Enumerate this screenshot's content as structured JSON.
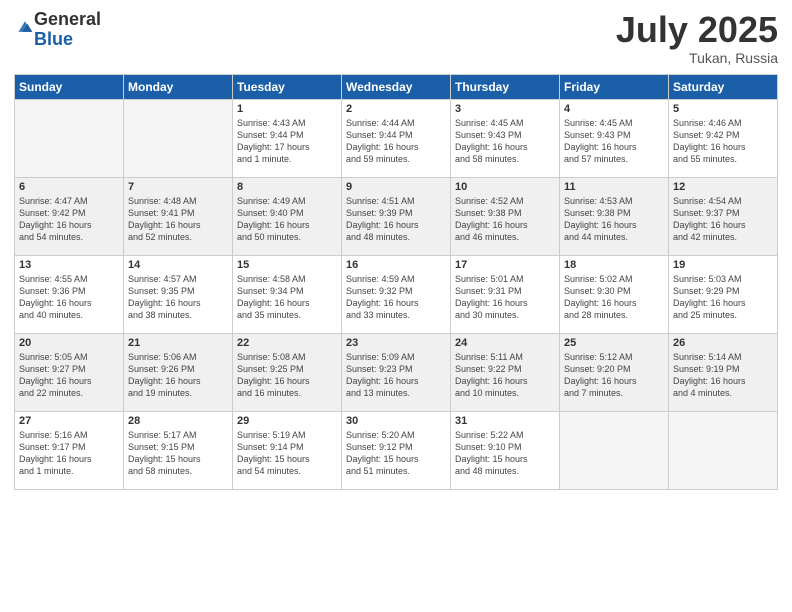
{
  "logo": {
    "general": "General",
    "blue": "Blue"
  },
  "title": {
    "month": "July 2025",
    "location": "Tukan, Russia"
  },
  "headers": [
    "Sunday",
    "Monday",
    "Tuesday",
    "Wednesday",
    "Thursday",
    "Friday",
    "Saturday"
  ],
  "weeks": [
    [
      {
        "day": "",
        "detail": ""
      },
      {
        "day": "",
        "detail": ""
      },
      {
        "day": "1",
        "detail": "Sunrise: 4:43 AM\nSunset: 9:44 PM\nDaylight: 17 hours\nand 1 minute."
      },
      {
        "day": "2",
        "detail": "Sunrise: 4:44 AM\nSunset: 9:44 PM\nDaylight: 16 hours\nand 59 minutes."
      },
      {
        "day": "3",
        "detail": "Sunrise: 4:45 AM\nSunset: 9:43 PM\nDaylight: 16 hours\nand 58 minutes."
      },
      {
        "day": "4",
        "detail": "Sunrise: 4:45 AM\nSunset: 9:43 PM\nDaylight: 16 hours\nand 57 minutes."
      },
      {
        "day": "5",
        "detail": "Sunrise: 4:46 AM\nSunset: 9:42 PM\nDaylight: 16 hours\nand 55 minutes."
      }
    ],
    [
      {
        "day": "6",
        "detail": "Sunrise: 4:47 AM\nSunset: 9:42 PM\nDaylight: 16 hours\nand 54 minutes."
      },
      {
        "day": "7",
        "detail": "Sunrise: 4:48 AM\nSunset: 9:41 PM\nDaylight: 16 hours\nand 52 minutes."
      },
      {
        "day": "8",
        "detail": "Sunrise: 4:49 AM\nSunset: 9:40 PM\nDaylight: 16 hours\nand 50 minutes."
      },
      {
        "day": "9",
        "detail": "Sunrise: 4:51 AM\nSunset: 9:39 PM\nDaylight: 16 hours\nand 48 minutes."
      },
      {
        "day": "10",
        "detail": "Sunrise: 4:52 AM\nSunset: 9:38 PM\nDaylight: 16 hours\nand 46 minutes."
      },
      {
        "day": "11",
        "detail": "Sunrise: 4:53 AM\nSunset: 9:38 PM\nDaylight: 16 hours\nand 44 minutes."
      },
      {
        "day": "12",
        "detail": "Sunrise: 4:54 AM\nSunset: 9:37 PM\nDaylight: 16 hours\nand 42 minutes."
      }
    ],
    [
      {
        "day": "13",
        "detail": "Sunrise: 4:55 AM\nSunset: 9:36 PM\nDaylight: 16 hours\nand 40 minutes."
      },
      {
        "day": "14",
        "detail": "Sunrise: 4:57 AM\nSunset: 9:35 PM\nDaylight: 16 hours\nand 38 minutes."
      },
      {
        "day": "15",
        "detail": "Sunrise: 4:58 AM\nSunset: 9:34 PM\nDaylight: 16 hours\nand 35 minutes."
      },
      {
        "day": "16",
        "detail": "Sunrise: 4:59 AM\nSunset: 9:32 PM\nDaylight: 16 hours\nand 33 minutes."
      },
      {
        "day": "17",
        "detail": "Sunrise: 5:01 AM\nSunset: 9:31 PM\nDaylight: 16 hours\nand 30 minutes."
      },
      {
        "day": "18",
        "detail": "Sunrise: 5:02 AM\nSunset: 9:30 PM\nDaylight: 16 hours\nand 28 minutes."
      },
      {
        "day": "19",
        "detail": "Sunrise: 5:03 AM\nSunset: 9:29 PM\nDaylight: 16 hours\nand 25 minutes."
      }
    ],
    [
      {
        "day": "20",
        "detail": "Sunrise: 5:05 AM\nSunset: 9:27 PM\nDaylight: 16 hours\nand 22 minutes."
      },
      {
        "day": "21",
        "detail": "Sunrise: 5:06 AM\nSunset: 9:26 PM\nDaylight: 16 hours\nand 19 minutes."
      },
      {
        "day": "22",
        "detail": "Sunrise: 5:08 AM\nSunset: 9:25 PM\nDaylight: 16 hours\nand 16 minutes."
      },
      {
        "day": "23",
        "detail": "Sunrise: 5:09 AM\nSunset: 9:23 PM\nDaylight: 16 hours\nand 13 minutes."
      },
      {
        "day": "24",
        "detail": "Sunrise: 5:11 AM\nSunset: 9:22 PM\nDaylight: 16 hours\nand 10 minutes."
      },
      {
        "day": "25",
        "detail": "Sunrise: 5:12 AM\nSunset: 9:20 PM\nDaylight: 16 hours\nand 7 minutes."
      },
      {
        "day": "26",
        "detail": "Sunrise: 5:14 AM\nSunset: 9:19 PM\nDaylight: 16 hours\nand 4 minutes."
      }
    ],
    [
      {
        "day": "27",
        "detail": "Sunrise: 5:16 AM\nSunset: 9:17 PM\nDaylight: 16 hours\nand 1 minute."
      },
      {
        "day": "28",
        "detail": "Sunrise: 5:17 AM\nSunset: 9:15 PM\nDaylight: 15 hours\nand 58 minutes."
      },
      {
        "day": "29",
        "detail": "Sunrise: 5:19 AM\nSunset: 9:14 PM\nDaylight: 15 hours\nand 54 minutes."
      },
      {
        "day": "30",
        "detail": "Sunrise: 5:20 AM\nSunset: 9:12 PM\nDaylight: 15 hours\nand 51 minutes."
      },
      {
        "day": "31",
        "detail": "Sunrise: 5:22 AM\nSunset: 9:10 PM\nDaylight: 15 hours\nand 48 minutes."
      },
      {
        "day": "",
        "detail": ""
      },
      {
        "day": "",
        "detail": ""
      }
    ]
  ]
}
